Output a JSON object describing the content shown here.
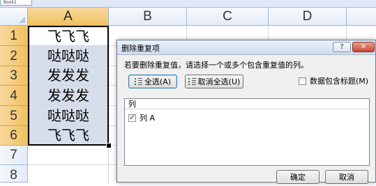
{
  "sheet": {
    "tab_label": "Book1",
    "columns": [
      "A",
      "B",
      "C",
      "D"
    ],
    "rows": [
      "1",
      "2",
      "3",
      "4",
      "5",
      "6",
      "7",
      "8"
    ],
    "column_a_values": [
      "飞飞飞",
      "哒哒哒",
      "发发发",
      "发发发",
      "哒哒哒",
      "飞飞飞"
    ]
  },
  "dialog": {
    "title": "删除重复项",
    "help_label": "?",
    "close_label": "✕",
    "prompt": "若要删除重复值，请选择一个或多个包含重复值的列。",
    "select_all_label": "全选(A)",
    "unselect_all_label": "取消全选(U)",
    "has_headers_label": "数据包含标题(M)",
    "has_headers_checked": false,
    "list_header": "列",
    "columns": [
      {
        "label": "列 A",
        "checked": true
      }
    ],
    "ok_label": "确定",
    "cancel_label": "取消"
  },
  "icons": {
    "select_all": "select-all-list-icon",
    "unselect_all": "unselect-all-list-icon",
    "fill_handle": "fill-handle-icon"
  },
  "colors": {
    "selection_fill": "#d7deeb",
    "header_highlight": "#f1c15f",
    "grid": "#d0d7e5"
  }
}
